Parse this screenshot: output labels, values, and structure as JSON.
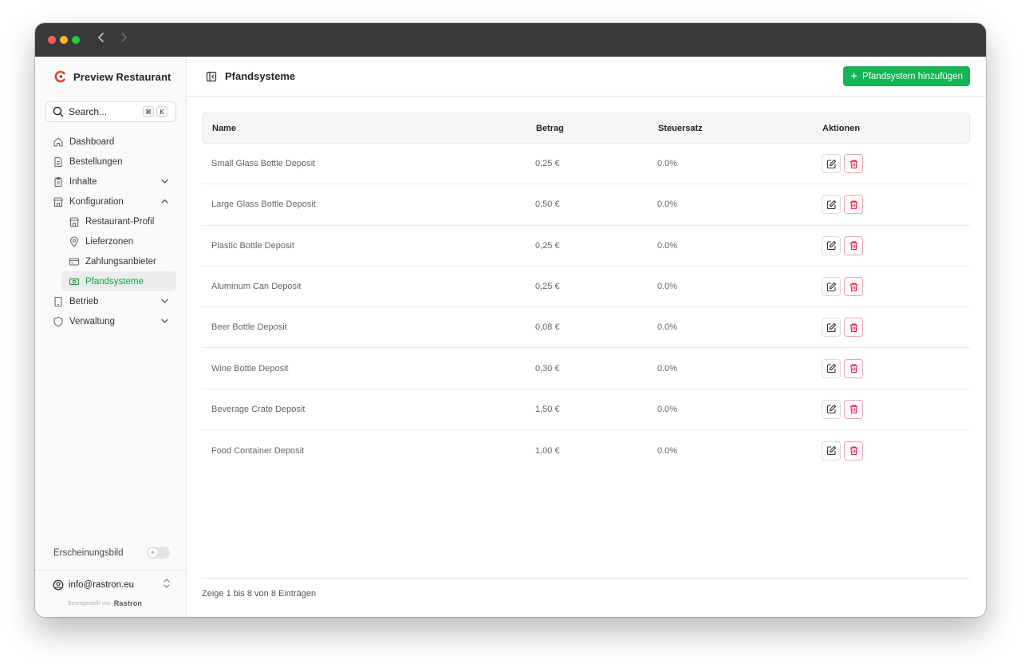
{
  "brand": {
    "name": "Preview Restaurant"
  },
  "search": {
    "placeholder": "Search...",
    "shortcut_mod": "⌘",
    "shortcut_key": "K"
  },
  "sidebar": {
    "items": [
      {
        "label": "Dashboard"
      },
      {
        "label": "Bestellungen"
      },
      {
        "label": "Inhalte"
      },
      {
        "label": "Konfiguration"
      },
      {
        "label": "Restaurant-Profil"
      },
      {
        "label": "Lieferzonen"
      },
      {
        "label": "Zahlungsanbieter"
      },
      {
        "label": "Pfandsysteme"
      },
      {
        "label": "Betrieb"
      },
      {
        "label": "Verwaltung"
      }
    ],
    "appearance_label": "Erscheinungsbild",
    "account_email": "info@rastron.eu",
    "powered_by": "Bereitgestellt von",
    "powered_brand": "Rastron"
  },
  "header": {
    "title": "Pfandsysteme",
    "add_button_label": "Pfandsystem hinzufügen"
  },
  "table": {
    "columns": [
      "Name",
      "Betrag",
      "Steuersatz",
      "Aktionen"
    ],
    "rows": [
      {
        "name": "Small Glass Bottle Deposit",
        "amount": "0,25 €",
        "tax": "0.0%"
      },
      {
        "name": "Large Glass Bottle Deposit",
        "amount": "0,50 €",
        "tax": "0.0%"
      },
      {
        "name": "Plastic Bottle Deposit",
        "amount": "0,25 €",
        "tax": "0.0%"
      },
      {
        "name": "Aluminum Can Deposit",
        "amount": "0,25 €",
        "tax": "0.0%"
      },
      {
        "name": "Beer Bottle Deposit",
        "amount": "0,08 €",
        "tax": "0.0%"
      },
      {
        "name": "Wine Bottle Deposit",
        "amount": "0,30 €",
        "tax": "0.0%"
      },
      {
        "name": "Beverage Crate Deposit",
        "amount": "1,50 €",
        "tax": "0.0%"
      },
      {
        "name": "Food Container Deposit",
        "amount": "1,00 €",
        "tax": "0.0%"
      }
    ]
  },
  "footer": {
    "pagination_text": "Zeige 1 bis 8 von 8 Einträgen"
  },
  "colors": {
    "accent": "#16b455",
    "active_text": "#16a34a",
    "danger": "#e11d48"
  },
  "icons": {
    "edit": "edit-icon",
    "delete": "trash-icon"
  }
}
